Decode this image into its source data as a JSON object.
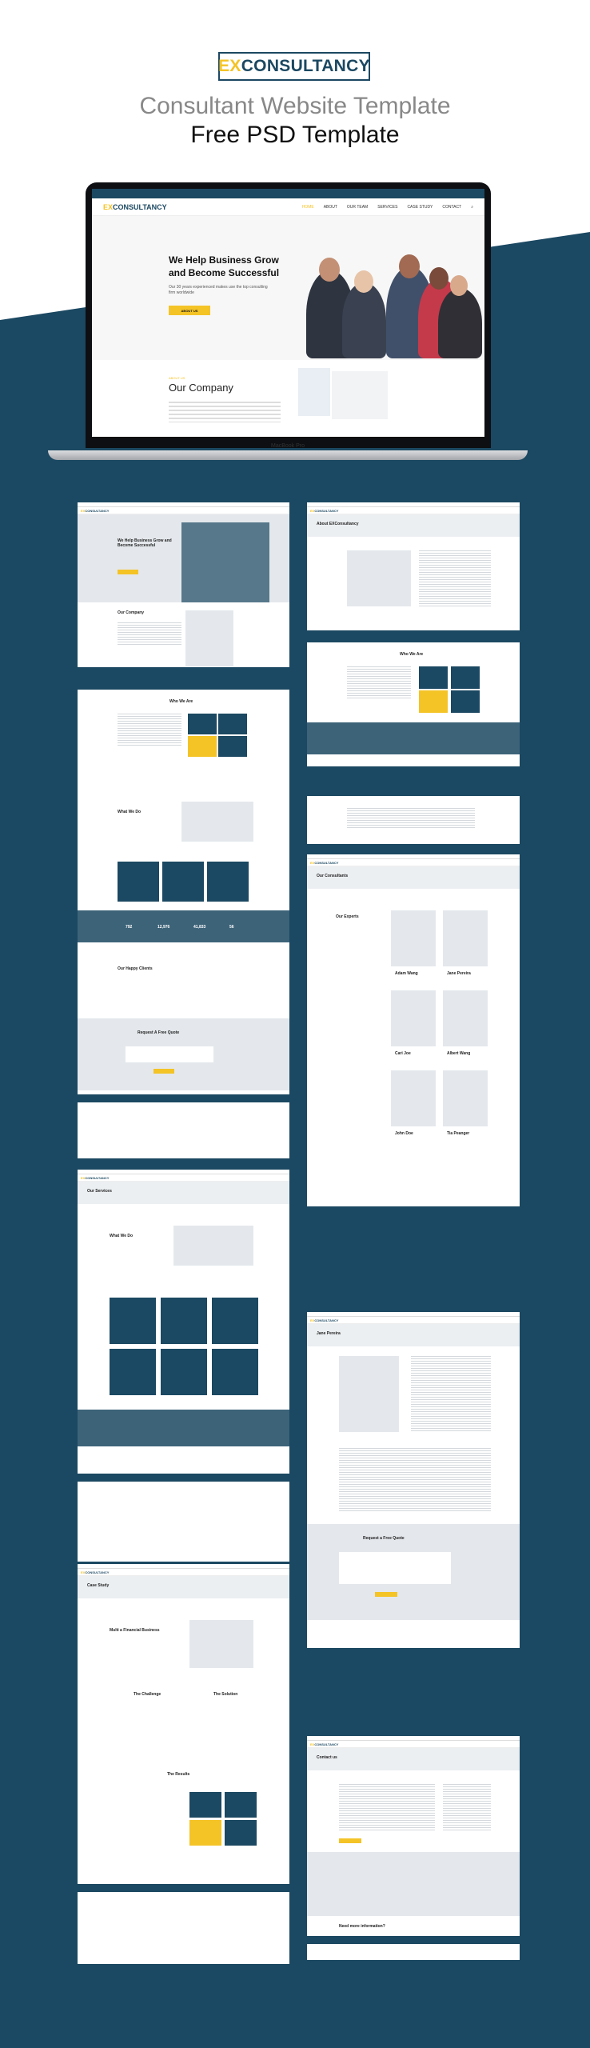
{
  "header": {
    "logo_prefix": "EX",
    "logo_rest": "CONSULTANCY",
    "subtitle": "Consultant Website Template",
    "title": "Free PSD Template"
  },
  "laptop": {
    "model": "MacBook Pro",
    "site": {
      "brand_prefix": "EX",
      "brand_rest": "CONSULTANCY",
      "nav": [
        "HOME",
        "ABOUT",
        "OUR TEAM",
        "SERVICES",
        "CASE STUDY",
        "CONTACT"
      ],
      "hero_title": "We Help Business Grow and Become Successful",
      "hero_text": "Our 30 years experienced makes use the top consulting firm worldwide",
      "hero_button": "ABOUT US",
      "company_label": "ABOUT US",
      "company_title": "Our Company"
    }
  },
  "thumbnails": [
    {
      "title": "We Help Business Grow and Become Successful",
      "sections": [
        "Our Company",
        "Who We Are",
        "What We Do",
        "Our Happy Clients",
        "Request A Free Quote"
      ]
    },
    {
      "title": "About EXConsultancy",
      "sections": [
        "Who We Are"
      ]
    },
    {
      "title": "Our Consultants",
      "sections": [
        "Our Experts"
      ],
      "names": [
        "Adam Wang",
        "Jane Pereira",
        "Cari Joe",
        "Albert Wang",
        "John Doe",
        "Tia Peanger"
      ]
    },
    {
      "title": "Our Services",
      "sections": [
        "What We Do"
      ]
    },
    {
      "title": "Jane Pereira",
      "sections": [
        "Request a Free Quote"
      ]
    },
    {
      "title": "Case Study",
      "sections": [
        "Multi a Financial Business",
        "The Challenge",
        "The Solution",
        "The Results"
      ]
    },
    {
      "title": "Contact us",
      "sections": []
    }
  ],
  "stats": [
    "792",
    "12,976",
    "41,833",
    "56"
  ],
  "cta": "Need more information?",
  "colors": {
    "navy": "#1b4862",
    "yellow": "#f4c326"
  }
}
